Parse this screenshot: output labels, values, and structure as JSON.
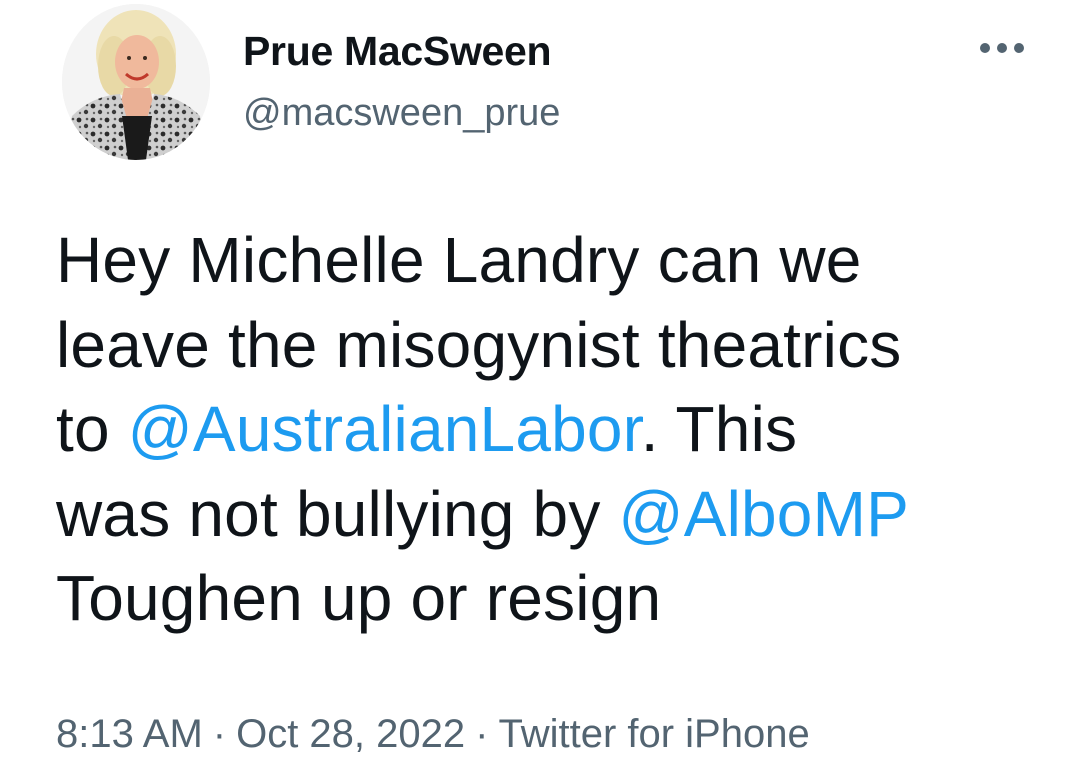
{
  "user": {
    "display_name": "Prue MacSween",
    "handle": "@macsween_prue",
    "avatar_icon": "profile-photo"
  },
  "more_icon": "more-horizontal-icon",
  "tweet": {
    "line1": "Hey Michelle Landry can we",
    "line2": "leave the misogynist theatrics",
    "line3_pre": "to ",
    "mention1": "@AustralianLabor",
    "line3_post": ". This",
    "line4_pre": "was not bullying by ",
    "mention2": "@AlboMP",
    "line5": "Toughen up or resign"
  },
  "meta": {
    "time": "8:13 AM",
    "separator": "·",
    "date": "Oct 28, 2022",
    "source": "Twitter for iPhone"
  },
  "colors": {
    "text": "#0f1419",
    "secondary": "#536471",
    "link": "#1d9bf0"
  }
}
